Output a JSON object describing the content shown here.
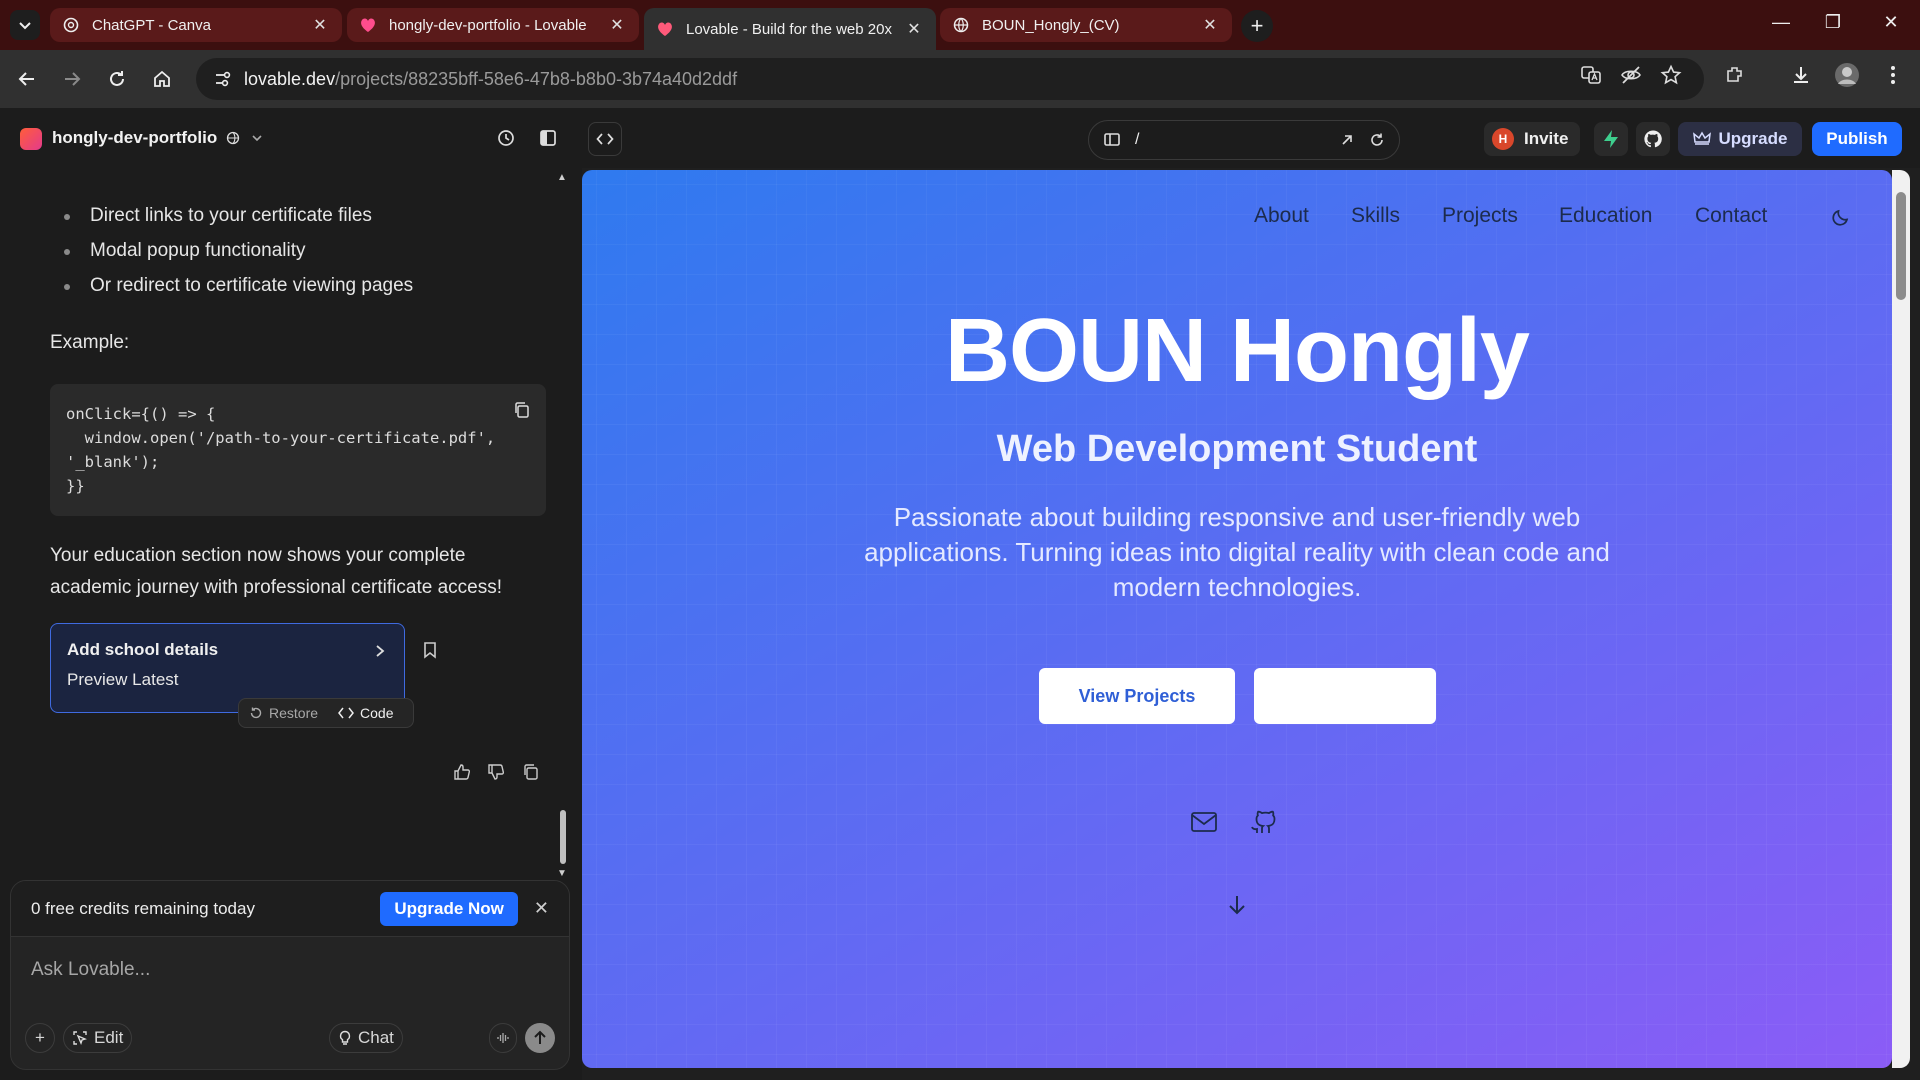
{
  "browser": {
    "tabs": [
      {
        "title": "ChatGPT - Canva",
        "icon": "openai-icon",
        "active": false
      },
      {
        "title": "hongly-dev-portfolio - Lovable",
        "icon": "lovable-heart-icon",
        "active": false
      },
      {
        "title": "Lovable - Build for the web 20x",
        "icon": "lovable-heart-icon",
        "active": true
      },
      {
        "title": "BOUN_Hongly_(CV)",
        "icon": "globe-icon",
        "active": false
      }
    ],
    "close_glyph": "✕",
    "new_tab_glyph": "+",
    "url_host": "lovable.dev",
    "url_path": "/projects/88235bff-58e6-47b8-b8b0-3b74a40d2ddf",
    "window_controls": {
      "minimize": "—",
      "restore": "❐",
      "close": "✕"
    }
  },
  "app": {
    "project_name": "hongly-dev-portfolio",
    "route_path": "/",
    "invite_avatar": "H",
    "invite_label": "Invite",
    "upgrade_label": "Upgrade",
    "publish_label": "Publish",
    "accent": "#1f6bff"
  },
  "chat": {
    "bullets": [
      "Direct links to your certificate files",
      "Modal popup functionality",
      "Or redirect to certificate viewing pages"
    ],
    "example_label": "Example:",
    "code_lines": [
      "onClick={() => {",
      "  window.open('/path-to-your-certificate.pdf',",
      "'_blank');",
      "}}"
    ],
    "education_message": "Your education section now shows your complete academic journey with professional certificate access!",
    "version_card": {
      "title": "Add school details",
      "subtitle": "Preview Latest"
    },
    "restore_label": "Restore",
    "code_label": "Code",
    "credits_text": "0 free credits remaining today",
    "upgrade_now_label": "Upgrade Now",
    "close_glyph": "✕",
    "ask_placeholder": "Ask Lovable...",
    "edit_label": "Edit",
    "chat_label": "Chat",
    "plus_glyph": "+"
  },
  "preview": {
    "nav": [
      "About",
      "Skills",
      "Projects",
      "Education",
      "Contact"
    ],
    "hero_title": "BOUN Hongly",
    "hero_subtitle": "Web Development Student",
    "hero_description": "Passionate about building responsive and user-friendly web applications. Turning ideas into digital reality with clean code and modern technologies.",
    "primary_button": "View Projects",
    "gradient": {
      "start": "#2f7aef",
      "end": "#8b5cf6"
    }
  }
}
